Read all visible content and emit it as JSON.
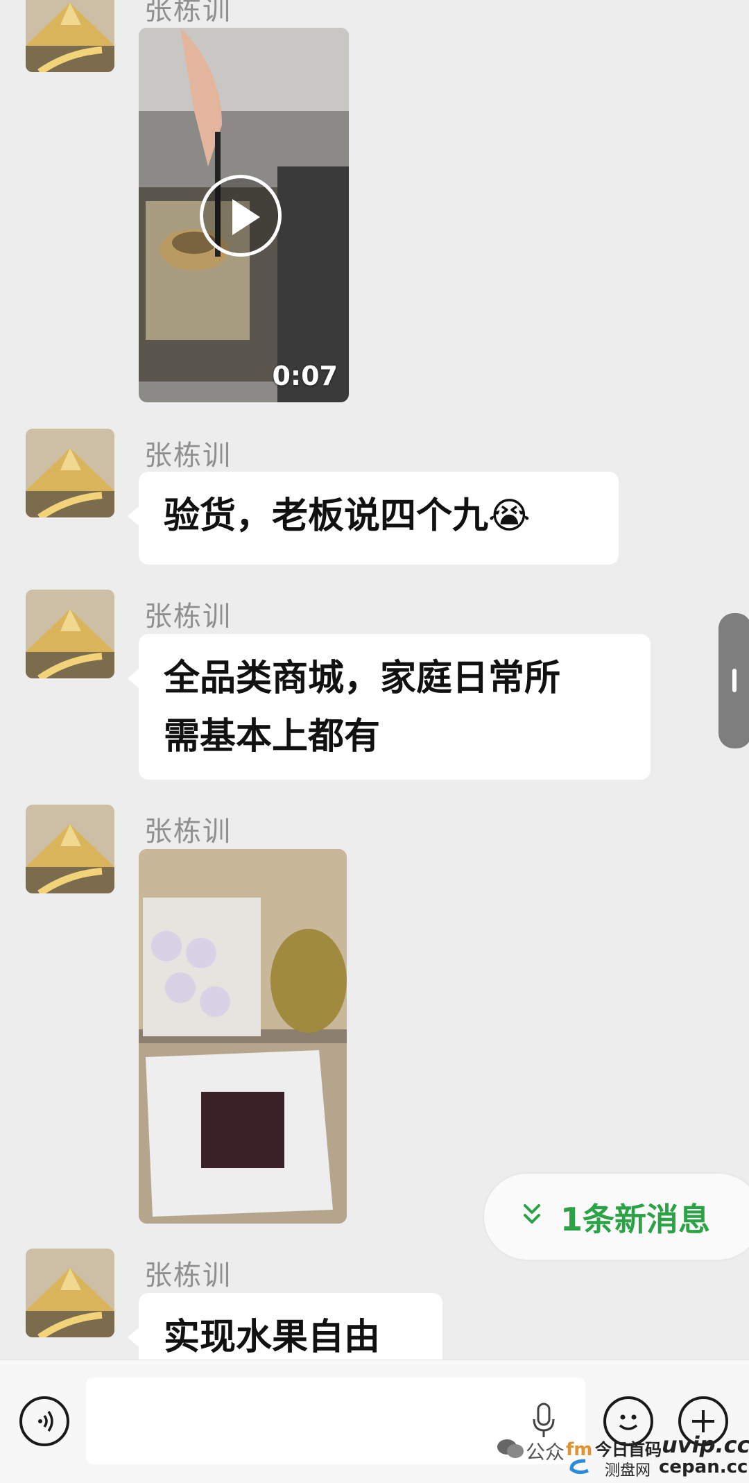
{
  "messages": [
    {
      "type": "video",
      "sender": "张栋训",
      "duration": "0:07"
    },
    {
      "type": "text",
      "sender": "张栋训",
      "lines": [
        "验货，老板说四个九😭"
      ]
    },
    {
      "type": "text",
      "sender": "张栋训",
      "lines": [
        "全品类商城，家庭日常所",
        "需基本上都有"
      ]
    },
    {
      "type": "image",
      "sender": "张栋训"
    },
    {
      "type": "text",
      "sender": "张栋训",
      "lines": [
        "实现水果自由"
      ]
    }
  ],
  "new_message_pill": {
    "label": "1条新消息",
    "color": "#2ba245"
  },
  "input_bar": {
    "icons": [
      "voice-icon",
      "mic-icon",
      "emoji-icon",
      "plus-icon"
    ]
  },
  "watermark": {
    "left_text": "公众",
    "line1": "今日首码",
    "domain1": "uvip.cc",
    "line2": "测盘网",
    "domain2": "cepan.cc"
  }
}
